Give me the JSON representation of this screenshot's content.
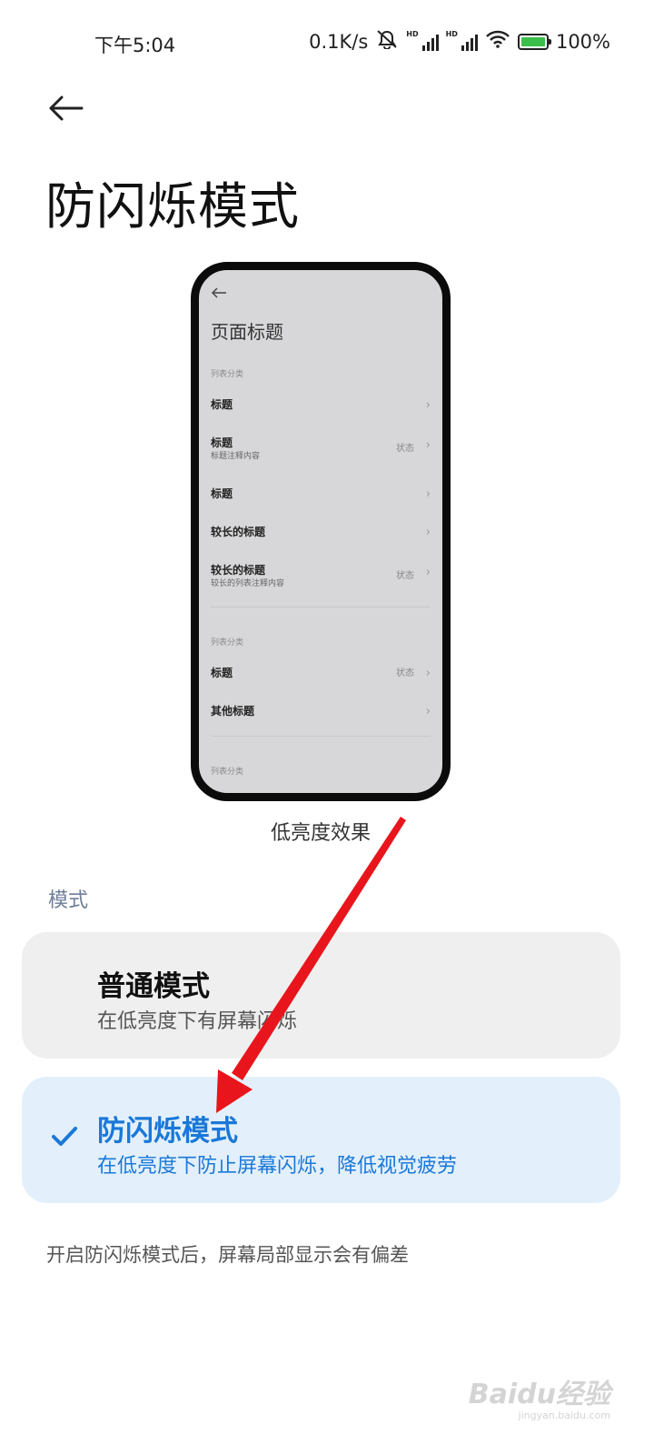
{
  "status_bar": {
    "time": "下午5:04",
    "net_speed": "0.1K/s",
    "hd1": "HD",
    "hd2": "HD",
    "battery": "100%"
  },
  "header": {
    "title": "防闪烁模式"
  },
  "preview": {
    "page_title": "页面标题",
    "category1": "列表分类",
    "rows1": [
      {
        "title": "标题"
      },
      {
        "title": "标题",
        "subtitle": "标题注释内容",
        "status": "状态"
      },
      {
        "title": "标题"
      },
      {
        "title": "较长的标题"
      },
      {
        "title": "较长的标题",
        "subtitle": "较长的列表注释内容",
        "status": "状态"
      }
    ],
    "category2": "列表分类",
    "rows2": [
      {
        "title": "标题",
        "status": "状态"
      },
      {
        "title": "其他标题"
      }
    ],
    "category3": "列表分类",
    "caption": "低亮度效果"
  },
  "modes": {
    "section_label": "模式",
    "options": [
      {
        "title": "普通模式",
        "subtitle": "在低亮度下有屏幕闪烁",
        "selected": false
      },
      {
        "title": "防闪烁模式",
        "subtitle": "在低亮度下防止屏幕闪烁，降低视觉疲劳",
        "selected": true
      }
    ]
  },
  "footnote": "开启防闪烁模式后，屏幕局部显示会有偏差",
  "watermark": {
    "main": "Baidu经验",
    "sub": "jingyan.baidu.com"
  },
  "colors": {
    "accent": "#1a78d8",
    "selected_card_bg": "#e3f0fb",
    "card_bg": "#efefef",
    "annotation_arrow": "#e8161c"
  }
}
